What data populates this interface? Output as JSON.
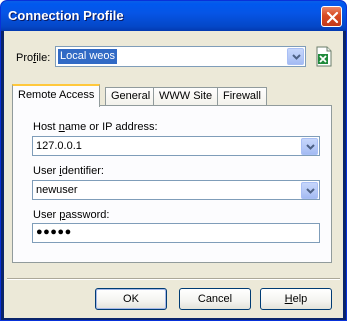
{
  "window": {
    "title": "Connection Profile"
  },
  "profile": {
    "label_before": "Pro",
    "label_underlined": "f",
    "label_after": "ile:",
    "selected_value": "Local weos"
  },
  "tabs": [
    {
      "label": "Remote Access",
      "active": true
    },
    {
      "label": "General",
      "active": false
    },
    {
      "label": "WWW Site",
      "active": false
    },
    {
      "label": "Firewall",
      "active": false
    }
  ],
  "remote_access": {
    "host": {
      "label_before": "Host ",
      "label_underlined": "n",
      "label_after": "ame or IP address:",
      "value": "127.0.0.1"
    },
    "user_id": {
      "label_before": "User ",
      "label_underlined": "i",
      "label_after": "dentifier:",
      "value": "newuser"
    },
    "password": {
      "label_before": "User ",
      "label_underlined": "p",
      "label_after": "assword:",
      "value": "●●●●●"
    }
  },
  "buttons": {
    "ok": "OK",
    "cancel": "Cancel",
    "help_underlined": "H",
    "help_rest": "elp"
  },
  "colors": {
    "title_bar": "#0054e3",
    "dialog_face": "#ece9d8",
    "selection": "#316ac5",
    "active_tab_accent": "#ffc83c"
  }
}
